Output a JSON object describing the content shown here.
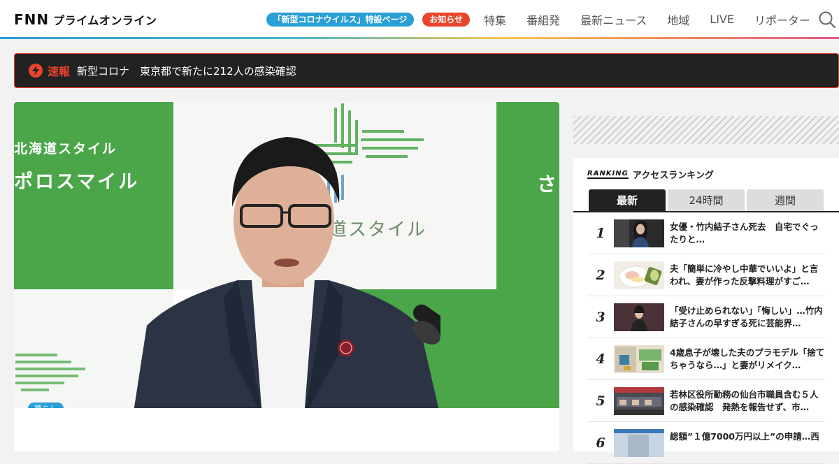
{
  "header": {
    "logo_main": "FNN",
    "logo_sub": "プライムオンライン",
    "pill_covid": "「新型コロナウイルス」特設ページ",
    "pill_notice": "お知らせ",
    "nav": [
      "特集",
      "番組発",
      "最新ニュース",
      "地域",
      "LIVE",
      "リポーター"
    ]
  },
  "breaking": {
    "label": "速報",
    "text": "新型コロナ　東京都で新たに212人の感染確認"
  },
  "article": {
    "hero_text_1": "北海道スタイル",
    "hero_text_2": "ポロスマイル",
    "hero_text_3": "道スタイル",
    "hero_text_4": "さ",
    "category": "暮らし"
  },
  "ranking": {
    "logo": "RANKING",
    "title": "アクセスランキング",
    "tabs": [
      "最新",
      "24時間",
      "週間"
    ],
    "items": [
      {
        "rank": "1",
        "text": "女優・竹内結子さん死去　自宅でぐったりと…"
      },
      {
        "rank": "2",
        "text": "夫「簡単に冷やし中華でいいよ」と言われ、妻が作った反撃料理がすご…"
      },
      {
        "rank": "3",
        "text": "「受け止められない」「悔しい」…竹内結子さんの早すぎる死に芸能界…"
      },
      {
        "rank": "4",
        "text": "4歳息子が壊した夫のプラモデル「捨てちゃうなら…」と妻がリメイク…"
      },
      {
        "rank": "5",
        "text": "若林区役所勤務の仙台市職員含む５人の感染確認　発熱を報告せず、市…"
      },
      {
        "rank": "6",
        "text": "総額”１億7000万円以上”の申請…西"
      }
    ]
  },
  "colors": {
    "accent_blue": "#2a9fd6",
    "accent_red": "#e8452c",
    "hero_green": "#4ba64a"
  }
}
